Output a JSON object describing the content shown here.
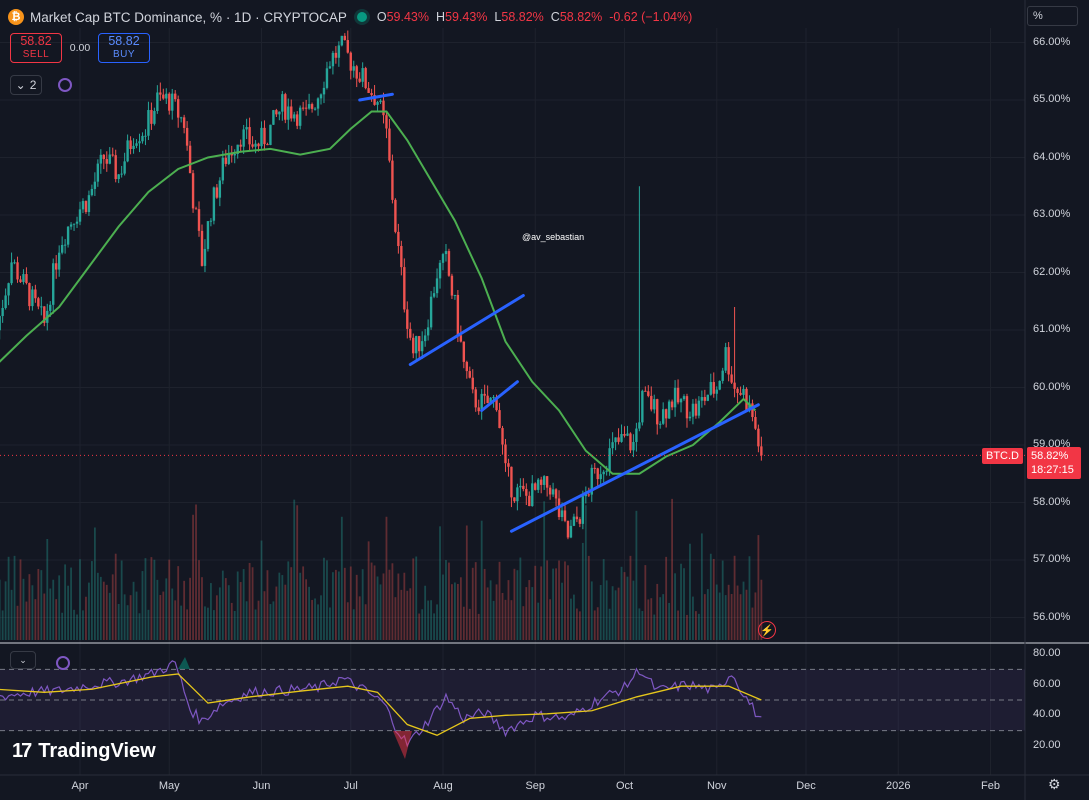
{
  "header": {
    "title": "Market Cap BTC Dominance, % · 1D · CRYPTOCAP",
    "logo_glyph": "₿",
    "ohlc": {
      "o_label": "O",
      "o": "59.43%",
      "h_label": "H",
      "h": "59.43%",
      "l_label": "L",
      "l": "58.82%",
      "c_label": "C",
      "c": "58.82%",
      "change": "-0.62 (−1.04%)"
    }
  },
  "trade": {
    "sell_price": "58.82",
    "sell_label": "SELL",
    "spread": "0.00",
    "buy_price": "58.82",
    "buy_label": "BUY"
  },
  "indicators": {
    "count": "2"
  },
  "scale_mode": "%",
  "symbol_label": "BTC.D",
  "last_price": "58.82%",
  "countdown": "18:27:15",
  "watermark": "@av_sebastian",
  "branding": {
    "logo_mark": "17",
    "name": "TradingView"
  },
  "colors": {
    "background": "#131722",
    "up": "#26a69a",
    "down": "#ef5350",
    "ma": "#4caf50",
    "trendline": "#2962ff",
    "rsi": "#7e57c2",
    "rsi_ma": "#e5c61b",
    "price_label": "#f23645"
  },
  "chart_data": [
    {
      "type": "candlestick",
      "title": "Market Cap BTC Dominance, % · 1D · CRYPTOCAP",
      "y_ticks": [
        "66.00%",
        "65.00%",
        "64.00%",
        "63.00%",
        "62.00%",
        "61.00%",
        "60.00%",
        "59.00%",
        "58.00%",
        "57.00%",
        "56.00%"
      ],
      "ylim": [
        55.6,
        66.1
      ],
      "x_ticks": [
        "Apr",
        "May",
        "Jun",
        "Jul",
        "Aug",
        "Sep",
        "Oct",
        "Nov",
        "Dec",
        "2026",
        "Feb"
      ],
      "x_tick_dates": [
        "2025-04-01",
        "2025-05-01",
        "2025-06-01",
        "2025-07-01",
        "2025-08-01",
        "2025-09-01",
        "2025-10-01",
        "2025-11-01",
        "2025-12-01",
        "2026-01-01",
        "2026-02-01"
      ],
      "close_path": [
        [
          "2025-03-04",
          61.0
        ],
        [
          "2025-03-09",
          62.2
        ],
        [
          "2025-03-14",
          61.7
        ],
        [
          "2025-03-20",
          61.1
        ],
        [
          "2025-03-25",
          62.5
        ],
        [
          "2025-03-30",
          63.0
        ],
        [
          "2025-04-04",
          63.3
        ],
        [
          "2025-04-09",
          64.0
        ],
        [
          "2025-04-14",
          63.7
        ],
        [
          "2025-04-19",
          64.4
        ],
        [
          "2025-04-23",
          64.5
        ],
        [
          "2025-04-27",
          65.0
        ],
        [
          "2025-05-01",
          65.0
        ],
        [
          "2025-05-06",
          64.6
        ],
        [
          "2025-05-09",
          63.3
        ],
        [
          "2025-05-12",
          62.2
        ],
        [
          "2025-05-15",
          63.1
        ],
        [
          "2025-05-20",
          64.0
        ],
        [
          "2025-05-25",
          64.4
        ],
        [
          "2025-05-30",
          64.2
        ],
        [
          "2025-06-03",
          64.4
        ],
        [
          "2025-06-08",
          64.9
        ],
        [
          "2025-06-12",
          64.8
        ],
        [
          "2025-06-16",
          64.7
        ],
        [
          "2025-06-20",
          65.1
        ],
        [
          "2025-06-24",
          65.7
        ],
        [
          "2025-06-28",
          65.9
        ],
        [
          "2025-07-02",
          65.6
        ],
        [
          "2025-07-06",
          65.3
        ],
        [
          "2025-07-10",
          65.0
        ],
        [
          "2025-07-13",
          64.4
        ],
        [
          "2025-07-16",
          62.8
        ],
        [
          "2025-07-19",
          61.5
        ],
        [
          "2025-07-22",
          60.6
        ],
        [
          "2025-07-26",
          61.0
        ],
        [
          "2025-07-30",
          62.0
        ],
        [
          "2025-08-02",
          62.2
        ],
        [
          "2025-08-05",
          61.4
        ],
        [
          "2025-08-08",
          60.4
        ],
        [
          "2025-08-11",
          59.8
        ],
        [
          "2025-08-15",
          59.7
        ],
        [
          "2025-08-19",
          59.8
        ],
        [
          "2025-08-22",
          58.5
        ],
        [
          "2025-08-25",
          58.2
        ],
        [
          "2025-08-29",
          58.1
        ],
        [
          "2025-09-02",
          58.2
        ],
        [
          "2025-09-06",
          58.3
        ],
        [
          "2025-09-09",
          57.8
        ],
        [
          "2025-09-12",
          57.4
        ],
        [
          "2025-09-16",
          57.8
        ],
        [
          "2025-09-20",
          58.4
        ],
        [
          "2025-09-24",
          58.7
        ],
        [
          "2025-09-28",
          59.0
        ],
        [
          "2025-10-01",
          59.1
        ],
        [
          "2025-10-04",
          59.0
        ],
        [
          "2025-10-07",
          59.8
        ],
        [
          "2025-10-10",
          59.7
        ],
        [
          "2025-10-13",
          59.5
        ],
        [
          "2025-10-17",
          59.8
        ],
        [
          "2025-10-21",
          59.7
        ],
        [
          "2025-10-25",
          59.6
        ],
        [
          "2025-10-29",
          59.9
        ],
        [
          "2025-11-01",
          60.0
        ],
        [
          "2025-11-04",
          60.6
        ],
        [
          "2025-11-07",
          60.0
        ],
        [
          "2025-11-10",
          59.9
        ],
        [
          "2025-11-13",
          59.5
        ],
        [
          "2025-11-16",
          58.82
        ]
      ],
      "ma_path": [
        [
          "2025-03-04",
          60.4
        ],
        [
          "2025-03-14",
          60.9
        ],
        [
          "2025-03-25",
          61.4
        ],
        [
          "2025-04-04",
          62.1
        ],
        [
          "2025-04-14",
          62.8
        ],
        [
          "2025-04-24",
          63.4
        ],
        [
          "2025-05-04",
          63.8
        ],
        [
          "2025-05-14",
          64.0
        ],
        [
          "2025-05-25",
          64.1
        ],
        [
          "2025-06-04",
          64.15
        ],
        [
          "2025-06-14",
          64.05
        ],
        [
          "2025-06-24",
          64.15
        ],
        [
          "2025-07-01",
          64.5
        ],
        [
          "2025-07-08",
          64.8
        ],
        [
          "2025-07-13",
          64.8
        ],
        [
          "2025-07-20",
          64.3
        ],
        [
          "2025-07-28",
          63.6
        ],
        [
          "2025-08-05",
          62.9
        ],
        [
          "2025-08-14",
          61.9
        ],
        [
          "2025-08-22",
          60.8
        ],
        [
          "2025-08-31",
          60.1
        ],
        [
          "2025-09-09",
          59.6
        ],
        [
          "2025-09-18",
          58.9
        ],
        [
          "2025-09-27",
          58.5
        ],
        [
          "2025-10-06",
          58.5
        ],
        [
          "2025-10-15",
          58.8
        ],
        [
          "2025-10-24",
          59.0
        ],
        [
          "2025-11-02",
          59.4
        ],
        [
          "2025-11-10",
          59.8
        ],
        [
          "2025-11-14",
          59.6
        ]
      ],
      "trendlines": [
        [
          [
            "2025-07-04",
            65.0
          ],
          [
            "2025-07-15",
            65.1
          ]
        ],
        [
          [
            "2025-07-21",
            60.4
          ],
          [
            "2025-08-28",
            61.6
          ]
        ],
        [
          [
            "2025-08-14",
            59.6
          ],
          [
            "2025-08-26",
            60.1
          ]
        ],
        [
          [
            "2025-08-24",
            57.5
          ],
          [
            "2025-11-15",
            59.7
          ]
        ]
      ],
      "spike_high": [
        [
          "2025-10-06",
          63.5
        ],
        [
          "2025-11-07",
          61.4
        ]
      ],
      "series": [
        {
          "name": "RSI",
          "panel": "rsi"
        }
      ]
    },
    {
      "type": "line",
      "y_ticks": [
        "80.00",
        "60.00",
        "40.00",
        "20.00"
      ],
      "ylim": [
        17,
        83
      ],
      "bands": [
        70,
        50,
        30
      ],
      "rsi_path": [
        [
          "2025-03-04",
          52
        ],
        [
          "2025-03-15",
          55
        ],
        [
          "2025-03-25",
          56
        ],
        [
          "2025-04-05",
          60
        ],
        [
          "2025-04-15",
          62
        ],
        [
          "2025-04-25",
          67
        ],
        [
          "2025-05-03",
          74
        ],
        [
          "2025-05-08",
          44
        ],
        [
          "2025-05-12",
          36
        ],
        [
          "2025-05-18",
          47
        ],
        [
          "2025-05-28",
          55
        ],
        [
          "2025-06-08",
          56
        ],
        [
          "2025-06-20",
          58
        ],
        [
          "2025-06-28",
          64
        ],
        [
          "2025-07-05",
          57
        ],
        [
          "2025-07-12",
          48
        ],
        [
          "2025-07-16",
          33
        ],
        [
          "2025-07-20",
          21
        ],
        [
          "2025-07-26",
          34
        ],
        [
          "2025-08-02",
          52
        ],
        [
          "2025-08-08",
          38
        ],
        [
          "2025-08-15",
          42
        ],
        [
          "2025-08-22",
          30
        ],
        [
          "2025-09-01",
          40
        ],
        [
          "2025-09-12",
          38
        ],
        [
          "2025-09-22",
          50
        ],
        [
          "2025-10-01",
          58
        ],
        [
          "2025-10-06",
          70
        ],
        [
          "2025-10-12",
          56
        ],
        [
          "2025-10-22",
          60
        ],
        [
          "2025-11-01",
          56
        ],
        [
          "2025-11-06",
          68
        ],
        [
          "2025-11-10",
          54
        ],
        [
          "2025-11-16",
          36
        ]
      ],
      "rsi_ma_path": [
        [
          "2025-03-04",
          57
        ],
        [
          "2025-03-20",
          55
        ],
        [
          "2025-04-05",
          57
        ],
        [
          "2025-04-25",
          65
        ],
        [
          "2025-05-04",
          67
        ],
        [
          "2025-05-14",
          48
        ],
        [
          "2025-05-28",
          52
        ],
        [
          "2025-06-15",
          56
        ],
        [
          "2025-06-30",
          59
        ],
        [
          "2025-07-10",
          55
        ],
        [
          "2025-07-20",
          34
        ],
        [
          "2025-07-30",
          27
        ],
        [
          "2025-08-10",
          38
        ],
        [
          "2025-08-22",
          40
        ],
        [
          "2025-09-05",
          41
        ],
        [
          "2025-09-20",
          43
        ],
        [
          "2025-10-05",
          52
        ],
        [
          "2025-10-20",
          59
        ],
        [
          "2025-11-05",
          59
        ],
        [
          "2025-11-16",
          50
        ]
      ]
    }
  ]
}
